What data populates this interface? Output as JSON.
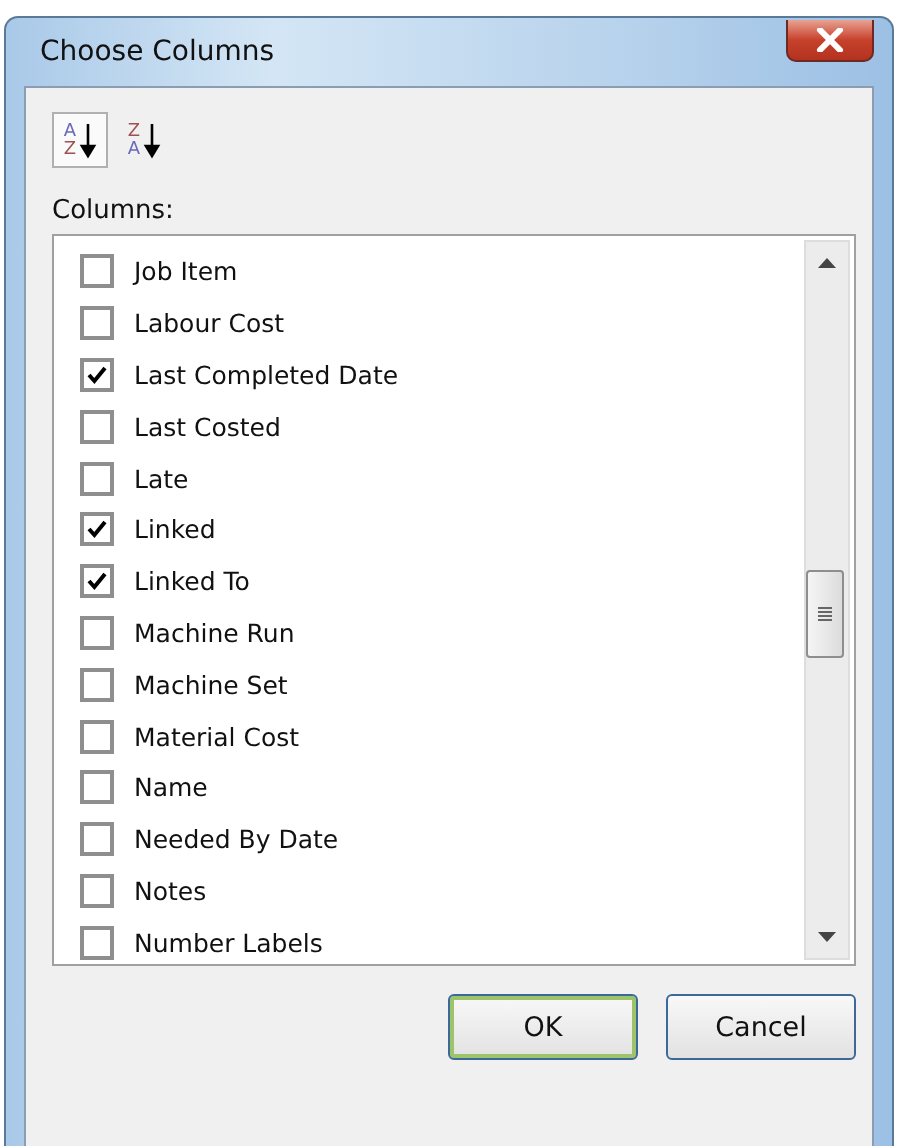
{
  "window": {
    "title": "Choose Columns"
  },
  "sort_buttons": [
    {
      "top": "A",
      "bottom": "Z",
      "selected": true
    },
    {
      "top": "Z",
      "bottom": "A",
      "selected": false
    }
  ],
  "columns_label": "Columns:",
  "columns": [
    {
      "label": "Job Item",
      "checked": false
    },
    {
      "label": "Labour Cost",
      "checked": false
    },
    {
      "label": "Last Completed Date",
      "checked": true
    },
    {
      "label": "Last Costed",
      "checked": false
    },
    {
      "label": "Late",
      "checked": false
    },
    {
      "label": "Linked",
      "checked": true
    },
    {
      "label": "Linked To",
      "checked": true
    },
    {
      "label": "Machine Run",
      "checked": false
    },
    {
      "label": "Machine Set",
      "checked": false
    },
    {
      "label": "Material Cost",
      "checked": false
    },
    {
      "label": "Name",
      "checked": false
    },
    {
      "label": "Needed By Date",
      "checked": false
    },
    {
      "label": "Notes",
      "checked": false
    },
    {
      "label": "Number Labels",
      "checked": false
    }
  ],
  "buttons": [
    {
      "label": "OK",
      "default": true
    },
    {
      "label": "Cancel",
      "default": false
    }
  ]
}
